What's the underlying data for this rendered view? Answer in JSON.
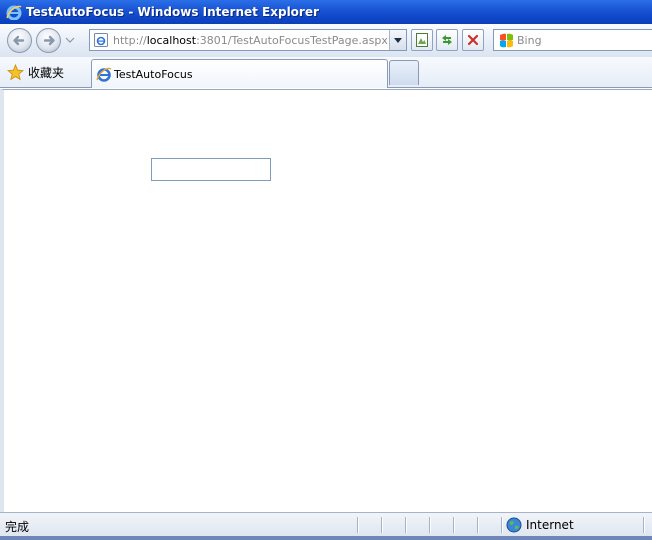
{
  "window": {
    "title": "TestAutoFocus - Windows Internet Explorer"
  },
  "navbar": {
    "url_prefix": "http://",
    "url_host": "localhost",
    "url_rest": ":3801/TestAutoFocusTestPage.aspx",
    "search_placeholder": "Bing"
  },
  "tabbar": {
    "favorites_label": "收藏夹",
    "tab_label": "TestAutoFocus"
  },
  "page": {
    "input_value": ""
  },
  "statusbar": {
    "status_text": "完成",
    "zone_label": "Internet"
  },
  "icons": {
    "window": "ie-logo-icon",
    "back": "back-arrow-icon",
    "forward": "forward-arrow-icon",
    "address": "page-icon",
    "compat": "compatibility-view-icon",
    "refresh": "refresh-icon",
    "stop": "stop-icon",
    "search": "bing-icon",
    "favorites": "star-icon",
    "zone": "globe-icon"
  },
  "colors": {
    "titlebar": "#1a55d4",
    "toolbar": "#e8eef8",
    "accent_blue": "#2f73d9",
    "stop_red": "#c8322a"
  }
}
